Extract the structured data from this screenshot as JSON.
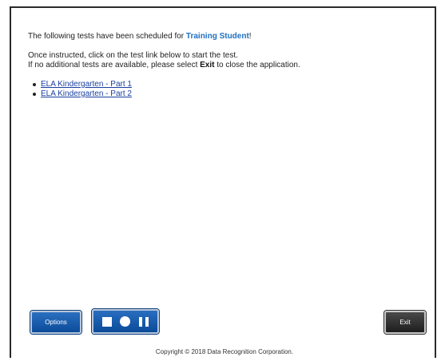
{
  "message": {
    "prefix": "The following tests have been scheduled for ",
    "student_name": "Training Student",
    "suffix": "!",
    "instruction1": "Once instructed, click on the test link below to start the test.",
    "instruction2_prefix": "If no additional tests are available, please select ",
    "instruction2_bold": "Exit",
    "instruction2_suffix": " to close the application."
  },
  "tests": [
    "ELA Kindergarten - Part 1",
    "ELA Kindergarten - Part 2"
  ],
  "toolbar": {
    "options_label": "Options",
    "exit_label": "Exit",
    "media_icons": [
      "stop-icon",
      "record-icon",
      "pause-icon"
    ]
  },
  "footer": {
    "copyright": "Copyright © 2018 Data Recognition Corporation."
  },
  "colors": {
    "student_name": "#1f6fc0",
    "link": "#1a3fa0",
    "button_blue": "#0b4c9a",
    "button_dark": "#1e1e1e"
  }
}
